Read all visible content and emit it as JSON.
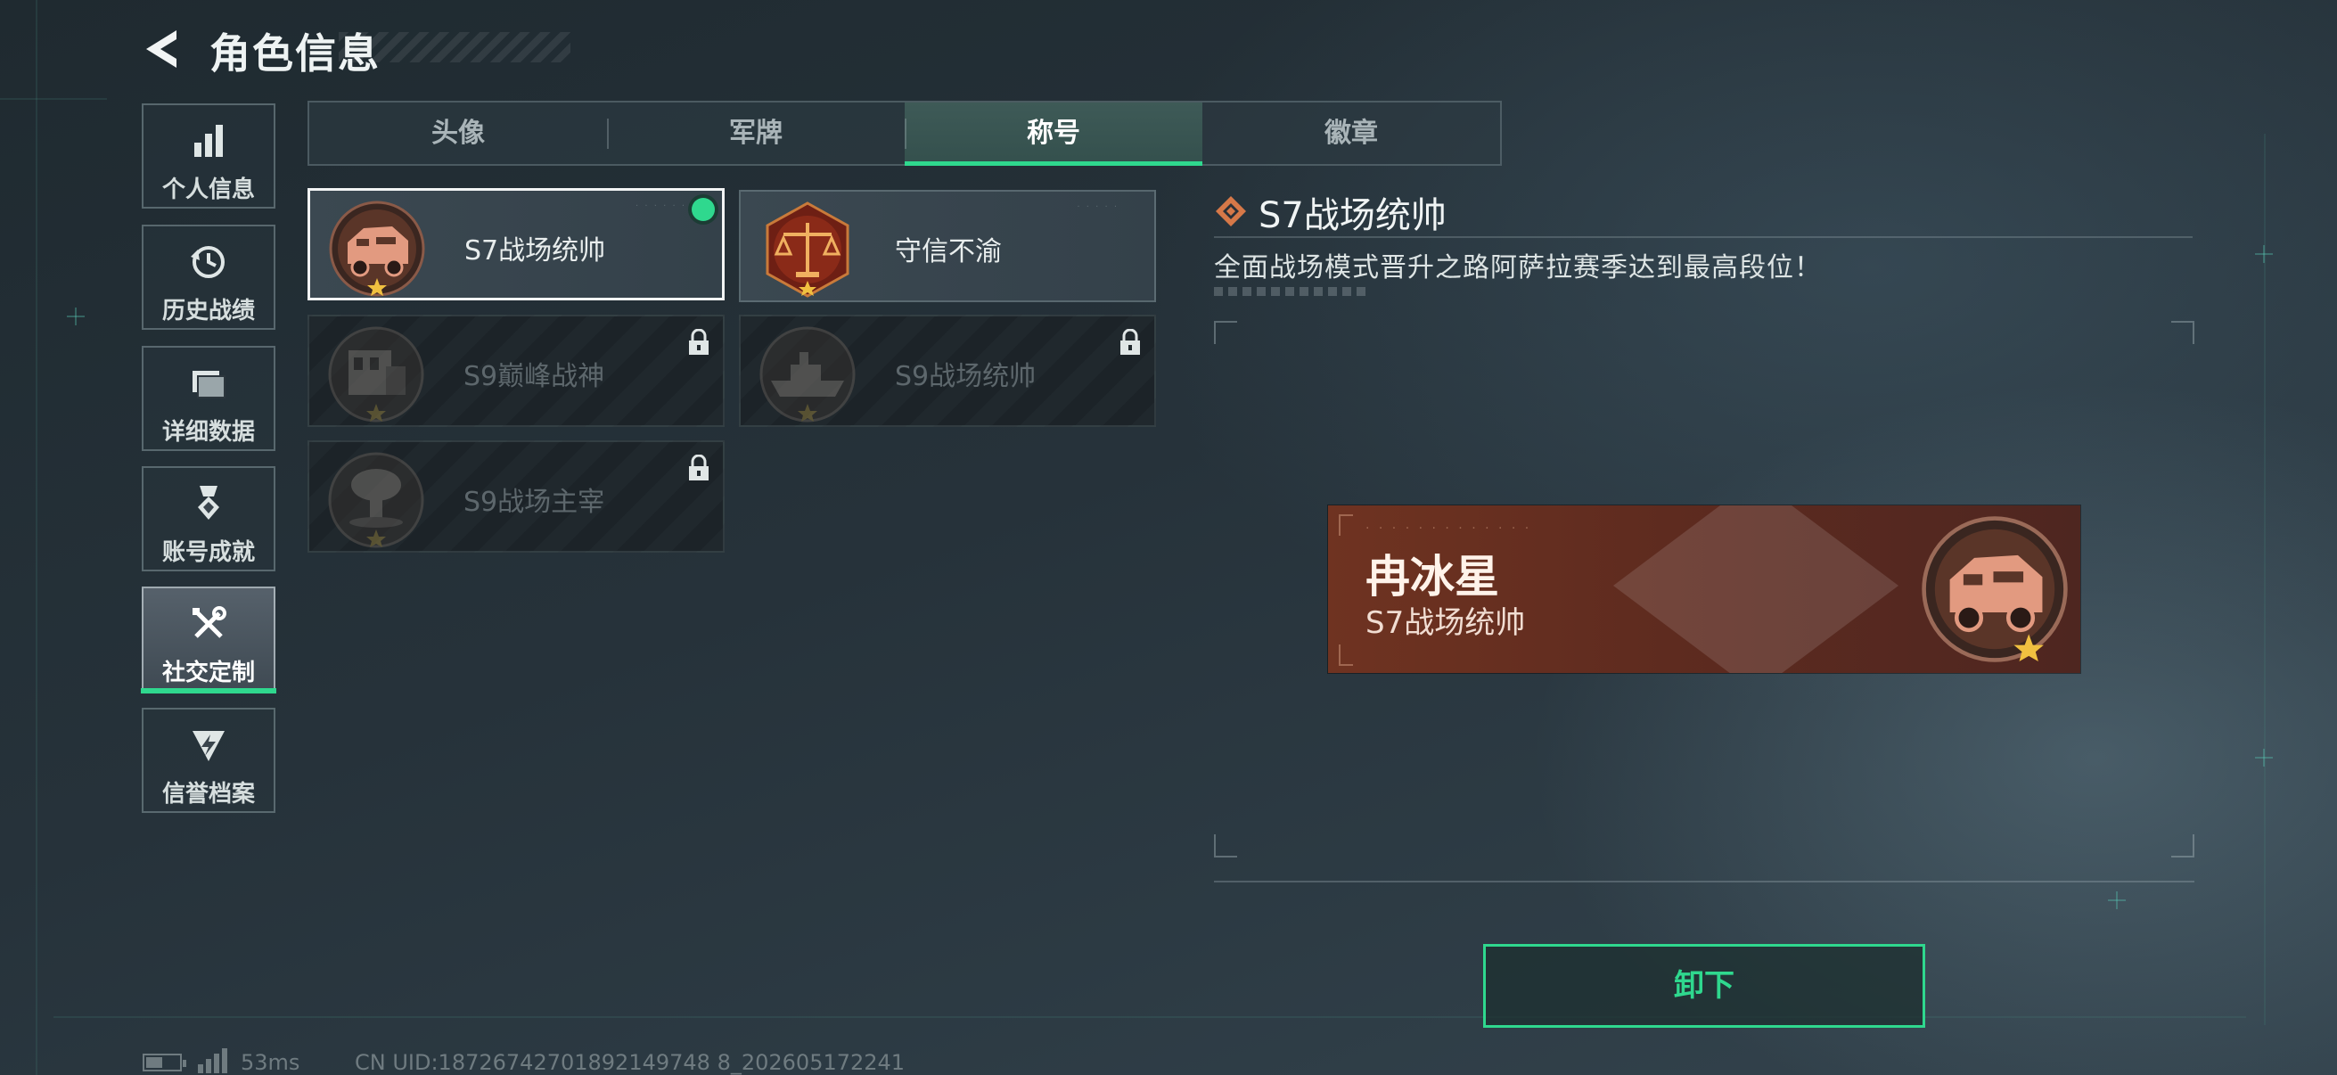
{
  "header": {
    "title": "角色信息"
  },
  "nav": {
    "items": [
      {
        "label": "个人信息",
        "icon": "bar-chart-icon",
        "active": false
      },
      {
        "label": "历史战绩",
        "icon": "history-icon",
        "active": false
      },
      {
        "label": "详细数据",
        "icon": "folder-icon",
        "active": false
      },
      {
        "label": "账号成就",
        "icon": "medal-icon",
        "active": false
      },
      {
        "label": "社交定制",
        "icon": "tools-icon",
        "active": true
      },
      {
        "label": "信誉档案",
        "icon": "shield-bolt-icon",
        "active": false
      }
    ]
  },
  "tabs": [
    {
      "label": "头像",
      "active": false
    },
    {
      "label": "军牌",
      "active": false
    },
    {
      "label": "称号",
      "active": true
    },
    {
      "label": "徽章",
      "active": false
    }
  ],
  "titles": [
    {
      "name": "S7战场统帅",
      "locked": false,
      "selected": true,
      "equipped": true,
      "emblem": "armored-vehicle-emblem"
    },
    {
      "name": "守信不渝",
      "locked": false,
      "selected": false,
      "equipped": false,
      "emblem": "scales-emblem"
    },
    {
      "name": "S9巅峰战神",
      "locked": true,
      "selected": false,
      "equipped": false,
      "emblem": "ruins-emblem"
    },
    {
      "name": "S9战场统帅",
      "locked": true,
      "selected": false,
      "equipped": false,
      "emblem": "warship-emblem"
    },
    {
      "name": "S9战场主宰",
      "locked": true,
      "selected": false,
      "equipped": false,
      "emblem": "mushroom-cloud-emblem"
    }
  ],
  "detail": {
    "title": "S7战场统帅",
    "description": "全面战场模式晋升之路阿萨拉赛季达到最高段位！"
  },
  "nameplate": {
    "player_name": "冉冰星",
    "title": "S7战场统帅"
  },
  "actions": {
    "unequip_label": "卸下"
  },
  "status": {
    "ping": "53ms",
    "uid": "CN UID:18726742701892149748 8_202605172241"
  },
  "colors": {
    "accent": "#2fd88e",
    "bronze": "#6f3321",
    "background": "#26323a"
  }
}
